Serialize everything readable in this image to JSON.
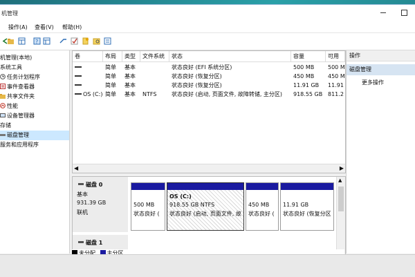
{
  "window": {
    "title": "机管理"
  },
  "menu": {
    "items": [
      "操作(A)",
      "查看(V)",
      "帮助(H)"
    ]
  },
  "toolbar": {
    "icons": [
      "back-icon",
      "forward-icon",
      "folder-icon",
      "grid-icon",
      "help-icon",
      "properties-icon",
      "connect-icon",
      "check-icon",
      "new-icon",
      "search-icon",
      "list-icon"
    ]
  },
  "tree": {
    "items": [
      {
        "label": "机管理(本地)",
        "icon": "computer-icon"
      },
      {
        "label": "系统工具",
        "icon": "tools-icon"
      },
      {
        "label": "任务计划程序",
        "icon": "clock-icon"
      },
      {
        "label": "事件查看器",
        "icon": "event-icon"
      },
      {
        "label": "共享文件夹",
        "icon": "folder-icon"
      },
      {
        "label": "性能",
        "icon": "performance-icon"
      },
      {
        "label": "设备管理器",
        "icon": "device-icon"
      },
      {
        "label": "存储",
        "icon": "storage-icon"
      },
      {
        "label": "磁盘管理",
        "icon": "disk-icon",
        "selected": true
      },
      {
        "label": "服务和应用程序",
        "icon": "services-icon"
      }
    ]
  },
  "volumes": {
    "columns": [
      "卷",
      "布局",
      "类型",
      "文件系统",
      "状态",
      "容量",
      "可用"
    ],
    "rows": [
      {
        "vol": "",
        "layout": "简单",
        "type": "基本",
        "fs": "",
        "status": "状态良好 (EFI 系统分区)",
        "capacity": "500 MB",
        "free": "500 M"
      },
      {
        "vol": "",
        "layout": "简单",
        "type": "基本",
        "fs": "",
        "status": "状态良好 (恢复分区)",
        "capacity": "450 MB",
        "free": "450 M"
      },
      {
        "vol": "",
        "layout": "简单",
        "type": "基本",
        "fs": "",
        "status": "状态良好 (恢复分区)",
        "capacity": "11.91 GB",
        "free": "11.91"
      },
      {
        "vol": "OS (C:)",
        "layout": "简单",
        "type": "基本",
        "fs": "NTFS",
        "status": "状态良好 (启动, 页面文件, 故障转储, 主分区)",
        "capacity": "918.55 GB",
        "free": "811.2"
      }
    ]
  },
  "disk0": {
    "name": "磁盘 0",
    "type": "基本",
    "size": "931.39 GB",
    "status": "联机",
    "partitions": [
      {
        "title": "",
        "size": "500 MB",
        "status": "状态良好 ("
      },
      {
        "title": "OS  (C:)",
        "size": "918.55 GB NTFS",
        "status": "状态良好 (启动, 页面文件, 故"
      },
      {
        "title": "",
        "size": "450 MB",
        "status": "状态良好 ("
      },
      {
        "title": "",
        "size": "11.91 GB",
        "status": "状态良好 (恢复分区"
      }
    ]
  },
  "disk1": {
    "name": "磁盘 1"
  },
  "legend": {
    "unallocated": "未分配",
    "primary": "主分区"
  },
  "actions": {
    "header": "操作",
    "section": "磁盘管理",
    "more": "更多操作"
  },
  "colors": {
    "partition_bar": "#1a1aa0",
    "unallocated": "#000000",
    "primary": "#1a1aa0",
    "selected": "#cce8ff"
  }
}
